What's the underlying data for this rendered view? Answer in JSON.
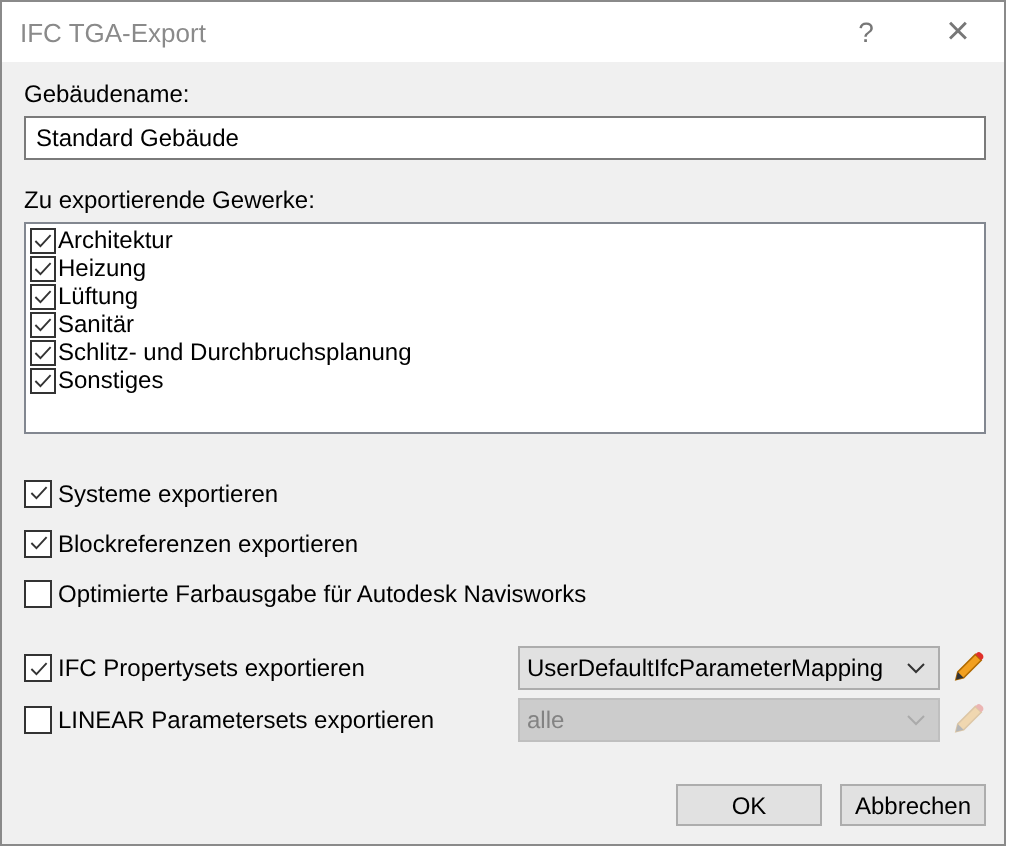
{
  "window": {
    "title": "IFC TGA-Export",
    "help": "?",
    "close": "×"
  },
  "building_name": {
    "label": "Gebäudename:",
    "value": "Standard Gebäude"
  },
  "trades": {
    "label": "Zu exportierende Gewerke:",
    "items": [
      {
        "label": "Architektur",
        "checked": true
      },
      {
        "label": "Heizung",
        "checked": true
      },
      {
        "label": "Lüftung",
        "checked": true
      },
      {
        "label": "Sanitär",
        "checked": true
      },
      {
        "label": "Schlitz- und Durchbruchsplanung",
        "checked": true
      },
      {
        "label": "Sonstiges",
        "checked": true
      }
    ]
  },
  "options": [
    {
      "kind": "checkbox",
      "label": "Systeme exportieren",
      "checked": true
    },
    {
      "kind": "checkbox",
      "label": "Blockreferenzen exportieren",
      "checked": true
    },
    {
      "kind": "checkbox",
      "label": "Optimierte Farbausgabe für Autodesk Navisworks",
      "checked": false
    },
    {
      "kind": "select",
      "label": "IFC Propertysets exportieren",
      "checked": true,
      "value": "UserDefaultIfcParameterMapping",
      "disabled": false
    },
    {
      "kind": "select",
      "label": "LINEAR Parametersets exportieren",
      "checked": false,
      "value": "alle",
      "disabled": true
    }
  ],
  "buttons": [
    "OK",
    "Abbrechen"
  ]
}
